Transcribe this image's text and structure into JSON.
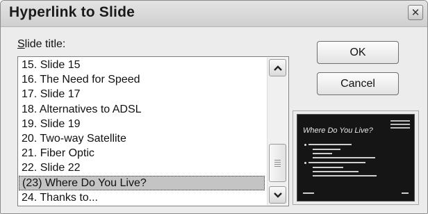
{
  "dialog": {
    "title": "Hyperlink to Slide",
    "close_icon": "close-icon"
  },
  "slide_title_label": {
    "mnemonic": "S",
    "rest": "lide title:"
  },
  "slide_list": {
    "items": [
      "15. Slide 15",
      "16. The Need for Speed",
      "17. Slide 17",
      "18. Alternatives to ADSL",
      "19. Slide 19",
      "20. Two-way Satellite",
      "21. Fiber Optic",
      "22. Slide 22",
      "(23) Where Do You Live?",
      "24. Thanks to..."
    ],
    "selected_index": 8
  },
  "buttons": {
    "ok": "OK",
    "cancel": "Cancel"
  },
  "preview": {
    "slide_title": "Where Do You Live?"
  }
}
